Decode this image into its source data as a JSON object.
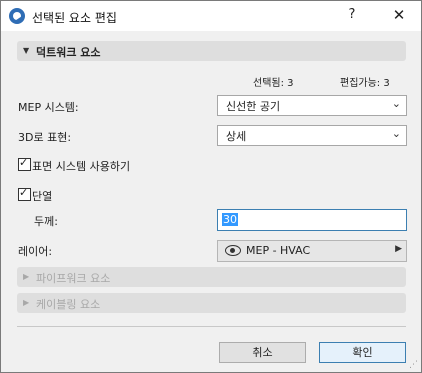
{
  "window": {
    "title": "선택된 요소 편집",
    "help_label": "?",
    "close_label": "✕"
  },
  "sections": {
    "ductwork": {
      "label": "덕트워크 요소",
      "state": "expanded"
    },
    "pipework": {
      "label": "파이프워크 요소",
      "state": "collapsed"
    },
    "cabling": {
      "label": "케이블링 요소",
      "state": "collapsed"
    }
  },
  "stats": {
    "selected": "선택됨: 3",
    "editable": "편집가능: 3"
  },
  "fields": {
    "mep_system": {
      "label": "MEP 시스템:",
      "value": "신선한 공기"
    },
    "represent_3d": {
      "label": "3D로 표현:",
      "value": "상세"
    },
    "surface_system": {
      "label": "표면 시스템 사용하기",
      "checked": true
    },
    "insulation": {
      "label": "단열",
      "checked": true
    },
    "thickness": {
      "label": "두께:",
      "value": "30"
    },
    "layer": {
      "label": "레이어:",
      "value": "MEP - HVAC"
    }
  },
  "buttons": {
    "cancel": "취소",
    "ok": "확인"
  },
  "icons": {
    "app": "archicad-logo-icon",
    "expand": "triangle-down-icon",
    "collapsed": "triangle-right-icon",
    "dropdown": "chevron-down-icon",
    "layer_visibility": "eye-icon",
    "layer_menu": "triangle-right-icon"
  },
  "colors": {
    "selection": "#3399ff",
    "focus_border": "#3c7fb1"
  }
}
